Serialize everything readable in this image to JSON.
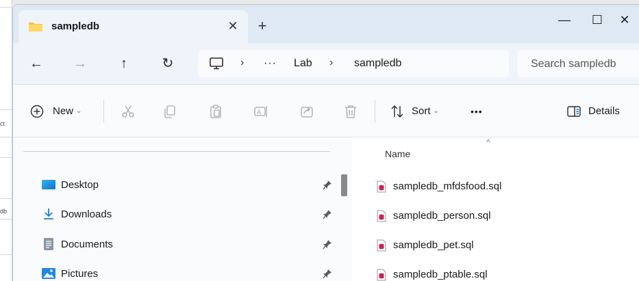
{
  "background_app": {
    "fragments": [
      "ct",
      "db"
    ]
  },
  "window": {
    "tab_title": "sampledb",
    "close_tab_glyph": "✕",
    "new_tab_glyph": "+",
    "controls": {
      "minimize": "—",
      "maximize": "☐",
      "close": "✕"
    }
  },
  "navigation": {
    "back": "←",
    "forward": "→",
    "up": "↑",
    "refresh": "↻",
    "breadcrumb": {
      "root_icon": "computer-icon",
      "separator": "›",
      "overflow": "···",
      "items": [
        "Lab",
        "sampledb"
      ]
    },
    "search_placeholder": "Search sampledb"
  },
  "command_bar": {
    "new_label": "New",
    "sort_label": "Sort",
    "more_label": "•••",
    "details_label": "Details",
    "caret": "⌄",
    "icons": [
      "cut-icon",
      "copy-icon",
      "paste-icon",
      "rename-icon",
      "share-icon",
      "delete-icon"
    ]
  },
  "nav_pane": {
    "items": [
      {
        "label": "Desktop",
        "icon": "desktop-icon",
        "pinned": true
      },
      {
        "label": "Downloads",
        "icon": "downloads-icon",
        "pinned": true
      },
      {
        "label": "Documents",
        "icon": "documents-icon",
        "pinned": true
      },
      {
        "label": "Pictures",
        "icon": "pictures-icon",
        "pinned": true
      }
    ]
  },
  "file_list": {
    "column_name": "Name",
    "sort_indicator": "^",
    "files": [
      {
        "name": "sampledb_mfdsfood.sql",
        "icon": "sql-file-icon"
      },
      {
        "name": "sampledb_person.sql",
        "icon": "sql-file-icon"
      },
      {
        "name": "sampledb_pet.sql",
        "icon": "sql-file-icon"
      },
      {
        "name": "sampledb_ptable.sql",
        "icon": "sql-file-icon"
      }
    ]
  },
  "colors": {
    "accent": "#0067c0",
    "folder": "#f6c342",
    "sql_file": "#c8235b",
    "download_arrow": "#1f7fd1"
  }
}
